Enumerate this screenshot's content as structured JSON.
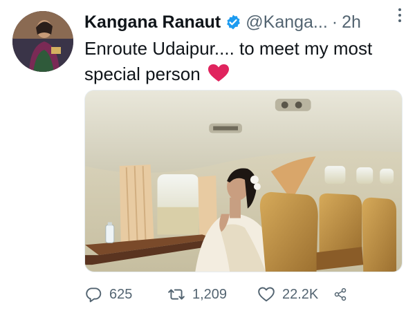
{
  "tweet": {
    "author_name": "Kangana Ranaut",
    "handle": "@Kanga...",
    "separator": "·",
    "time": "2h",
    "text": "Enroute Udaipur.... to meet my most special person",
    "emoji": "red-heart"
  },
  "actions": {
    "replies": "625",
    "retweets": "1,209",
    "likes": "22.2K"
  },
  "colors": {
    "verified_badge": "#1d9bf0",
    "secondary_text": "#536471",
    "heart_emoji": "#e0245e"
  },
  "icons": {
    "verified": "verified-badge-icon",
    "more": "more-vertical-icon",
    "reply": "reply-icon",
    "retweet": "retweet-icon",
    "like": "heart-icon",
    "share": "share-icon"
  }
}
